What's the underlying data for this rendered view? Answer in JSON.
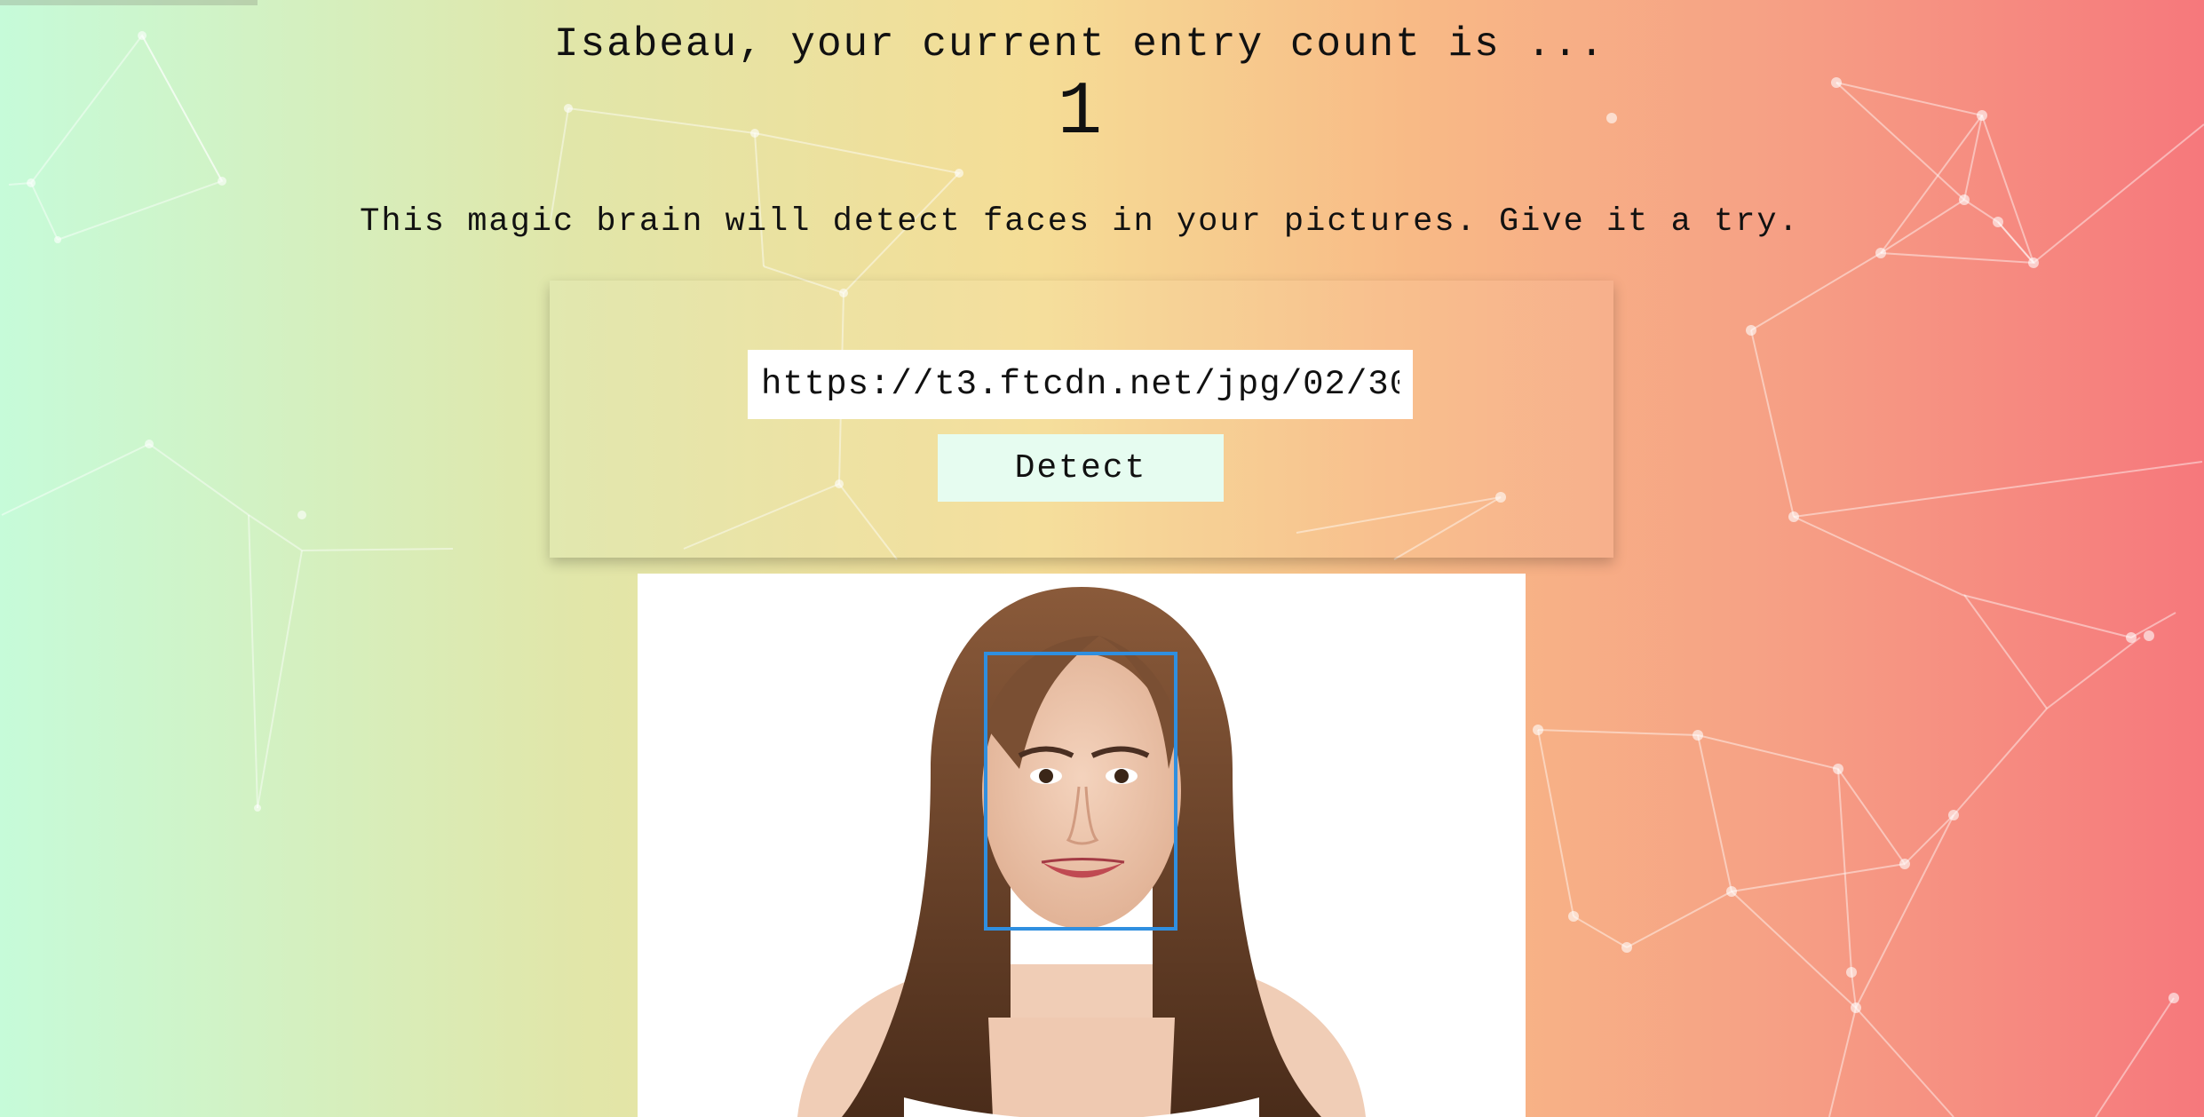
{
  "greeting": "Isabeau, your current entry count is ...",
  "entry_count": "1",
  "tagline": "This magic brain will detect faces in your pictures. Give it a try.",
  "image_url_input": {
    "value": "https://t3.ftcdn.net/jpg/02/30"
  },
  "detect_button": {
    "label": "Detect"
  },
  "colors": {
    "gradient": [
      "#c6fbd9",
      "#f5dd96",
      "#f6787c"
    ],
    "face_box": "#2f8fe0",
    "button_bg": "#e6fcf0"
  },
  "icons": {
    "face_box": "face-bounding-box"
  }
}
